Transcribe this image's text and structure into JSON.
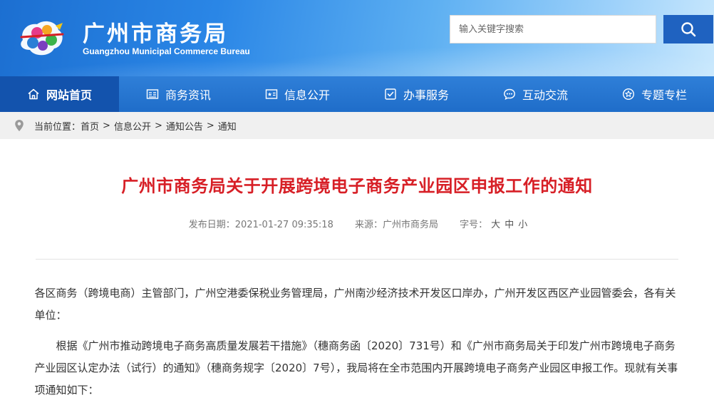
{
  "header": {
    "title": "广州市商务局",
    "subtitle": "Guangzhou Municipal Commerce Bureau",
    "search_placeholder": "输入关键字搜索",
    "colors": {
      "accent": "#1f62c0",
      "nav": "#2a78d3",
      "nav_active": "#1353ad"
    }
  },
  "nav": {
    "items": [
      {
        "label": "网站首页",
        "icon": "home-icon"
      },
      {
        "label": "商务资讯",
        "icon": "news-icon"
      },
      {
        "label": "信息公开",
        "icon": "info-icon"
      },
      {
        "label": "办事服务",
        "icon": "service-icon"
      },
      {
        "label": "互动交流",
        "icon": "chat-icon"
      },
      {
        "label": "专题专栏",
        "icon": "star-icon"
      }
    ]
  },
  "breadcrumb": {
    "prefix": "当前位置：",
    "items": [
      "首页",
      "信息公开",
      "通知公告",
      "通知"
    ],
    "separator": ">"
  },
  "article": {
    "title": "广州市商务局关于开展跨境电子商务产业园区申报工作的通知",
    "date_label": "发布日期：2021-01-27 09:35:18",
    "source_label": "来源：广州市商务局",
    "font_label": "字号：",
    "font_sizes": [
      "大",
      "中",
      "小"
    ],
    "title_color": "#d71f26",
    "paragraphs": [
      "各区商务（跨境电商）主管部门，广州空港委保税业务管理局，广州南沙经济技术开发区口岸办，广州开发区西区产业园管委会，各有关单位：",
      "根据《广州市推动跨境电子商务高质量发展若干措施》（穗商务函〔2020〕731号）和《广州市商务局关于印发广州市跨境电子商务产业园区认定办法（试行）的通知》（穗商务规字〔2020〕7号），我局将在全市范围内开展跨境电子商务产业园区申报工作。现就有关事项通知如下："
    ]
  }
}
